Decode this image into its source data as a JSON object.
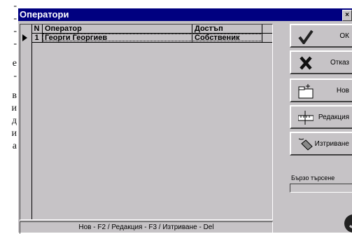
{
  "background_text": [
    "-",
    "-",
    "-",
    "-",
    "е",
    "-",
    "в",
    "и",
    "д",
    "и",
    "а"
  ],
  "window": {
    "title": "Оператори",
    "close_glyph": "×"
  },
  "grid": {
    "columns": [
      "N",
      "Оператор",
      "Достъп"
    ],
    "rows": [
      {
        "n": "1",
        "operator": "Георги Георгиев",
        "access": "Собственик"
      }
    ]
  },
  "buttons": {
    "ok": "ОК",
    "cancel": "Отказ",
    "new": "Нов",
    "edit": "Редакция",
    "delete": "Изтриване"
  },
  "quick_search": {
    "label": "Бързо търсене",
    "value": ""
  },
  "status": "Нов - F2 / Редакция - F3 / Изтриване - Del"
}
